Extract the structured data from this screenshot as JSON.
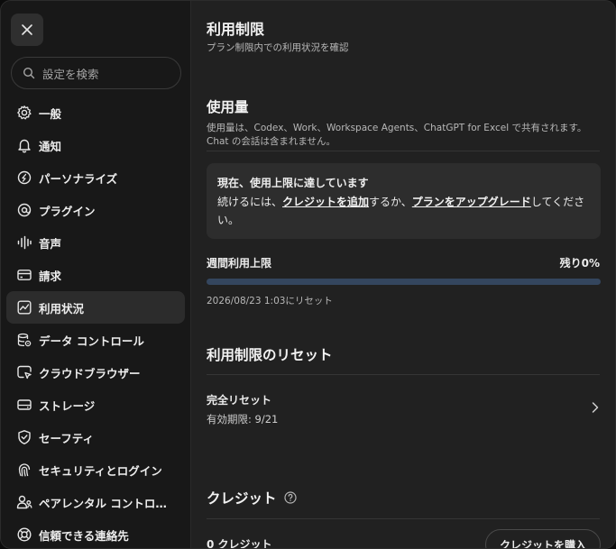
{
  "sidebar": {
    "close_icon": "close-icon",
    "search_placeholder": "設定を検索",
    "items": [
      {
        "label": "一般",
        "icon": "gear-icon"
      },
      {
        "label": "通知",
        "icon": "bell-icon"
      },
      {
        "label": "パーソナライズ",
        "icon": "personalize-icon"
      },
      {
        "label": "プラグイン",
        "icon": "plugin-icon"
      },
      {
        "label": "音声",
        "icon": "audio-wave-icon"
      },
      {
        "label": "請求",
        "icon": "credit-card-icon"
      },
      {
        "label": "利用状況",
        "icon": "usage-chart-icon",
        "active": true
      },
      {
        "label": "データ コントロール",
        "icon": "data-control-icon"
      },
      {
        "label": "クラウドブラウザー",
        "icon": "cloud-browser-icon"
      },
      {
        "label": "ストレージ",
        "icon": "storage-icon"
      },
      {
        "label": "セーフティ",
        "icon": "shield-check-icon"
      },
      {
        "label": "セキュリティとログイン",
        "icon": "security-login-icon"
      },
      {
        "label": "ペアレンタル コントロ…",
        "icon": "parental-control-icon"
      },
      {
        "label": "信頼できる連絡先",
        "icon": "lifebuoy-icon"
      }
    ]
  },
  "main": {
    "title": "利用制限",
    "subtitle": "プラン制限内での利用状況を確認",
    "usage": {
      "heading": "使用量",
      "description": "使用量は、Codex、Work、Workspace Agents、ChatGPT for Excel で共有されます。Chat の会話は含まれません。"
    },
    "alert": {
      "title": "現在、使用上限に達しています",
      "prefix": "続けるには、",
      "link1": "クレジットを追加",
      "middle": "するか、",
      "link2": "プランをアップグレード",
      "suffix": "してください。"
    },
    "weekly": {
      "label": "週間利用上限",
      "remaining_text": "残り0%",
      "remaining_fraction": 0.0,
      "reset_time": "2026/08/23 1:03にリセット"
    },
    "reset_section": {
      "heading": "利用制限のリセット",
      "item_title": "完全リセット",
      "item_expiry": "有効期限: 9/21"
    },
    "credits": {
      "heading": "クレジット",
      "count_text": "0 クレジット",
      "buy_label": "クレジットを購入"
    }
  },
  "colors": {
    "bar_fill": "#2f7df6",
    "bar_track": "#34465e",
    "sidebar_bg": "#181818",
    "main_bg": "#212121"
  }
}
